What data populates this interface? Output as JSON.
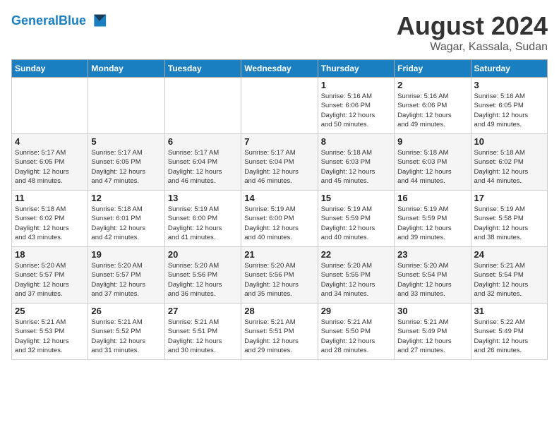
{
  "logo": {
    "line1": "General",
    "line2": "Blue"
  },
  "title": "August 2024",
  "subtitle": "Wagar, Kassala, Sudan",
  "days_of_week": [
    "Sunday",
    "Monday",
    "Tuesday",
    "Wednesday",
    "Thursday",
    "Friday",
    "Saturday"
  ],
  "weeks": [
    [
      {
        "day": "",
        "info": ""
      },
      {
        "day": "",
        "info": ""
      },
      {
        "day": "",
        "info": ""
      },
      {
        "day": "",
        "info": ""
      },
      {
        "day": "1",
        "info": "Sunrise: 5:16 AM\nSunset: 6:06 PM\nDaylight: 12 hours\nand 50 minutes."
      },
      {
        "day": "2",
        "info": "Sunrise: 5:16 AM\nSunset: 6:06 PM\nDaylight: 12 hours\nand 49 minutes."
      },
      {
        "day": "3",
        "info": "Sunrise: 5:16 AM\nSunset: 6:05 PM\nDaylight: 12 hours\nand 49 minutes."
      }
    ],
    [
      {
        "day": "4",
        "info": "Sunrise: 5:17 AM\nSunset: 6:05 PM\nDaylight: 12 hours\nand 48 minutes."
      },
      {
        "day": "5",
        "info": "Sunrise: 5:17 AM\nSunset: 6:05 PM\nDaylight: 12 hours\nand 47 minutes."
      },
      {
        "day": "6",
        "info": "Sunrise: 5:17 AM\nSunset: 6:04 PM\nDaylight: 12 hours\nand 46 minutes."
      },
      {
        "day": "7",
        "info": "Sunrise: 5:17 AM\nSunset: 6:04 PM\nDaylight: 12 hours\nand 46 minutes."
      },
      {
        "day": "8",
        "info": "Sunrise: 5:18 AM\nSunset: 6:03 PM\nDaylight: 12 hours\nand 45 minutes."
      },
      {
        "day": "9",
        "info": "Sunrise: 5:18 AM\nSunset: 6:03 PM\nDaylight: 12 hours\nand 44 minutes."
      },
      {
        "day": "10",
        "info": "Sunrise: 5:18 AM\nSunset: 6:02 PM\nDaylight: 12 hours\nand 44 minutes."
      }
    ],
    [
      {
        "day": "11",
        "info": "Sunrise: 5:18 AM\nSunset: 6:02 PM\nDaylight: 12 hours\nand 43 minutes."
      },
      {
        "day": "12",
        "info": "Sunrise: 5:18 AM\nSunset: 6:01 PM\nDaylight: 12 hours\nand 42 minutes."
      },
      {
        "day": "13",
        "info": "Sunrise: 5:19 AM\nSunset: 6:00 PM\nDaylight: 12 hours\nand 41 minutes."
      },
      {
        "day": "14",
        "info": "Sunrise: 5:19 AM\nSunset: 6:00 PM\nDaylight: 12 hours\nand 40 minutes."
      },
      {
        "day": "15",
        "info": "Sunrise: 5:19 AM\nSunset: 5:59 PM\nDaylight: 12 hours\nand 40 minutes."
      },
      {
        "day": "16",
        "info": "Sunrise: 5:19 AM\nSunset: 5:59 PM\nDaylight: 12 hours\nand 39 minutes."
      },
      {
        "day": "17",
        "info": "Sunrise: 5:19 AM\nSunset: 5:58 PM\nDaylight: 12 hours\nand 38 minutes."
      }
    ],
    [
      {
        "day": "18",
        "info": "Sunrise: 5:20 AM\nSunset: 5:57 PM\nDaylight: 12 hours\nand 37 minutes."
      },
      {
        "day": "19",
        "info": "Sunrise: 5:20 AM\nSunset: 5:57 PM\nDaylight: 12 hours\nand 37 minutes."
      },
      {
        "day": "20",
        "info": "Sunrise: 5:20 AM\nSunset: 5:56 PM\nDaylight: 12 hours\nand 36 minutes."
      },
      {
        "day": "21",
        "info": "Sunrise: 5:20 AM\nSunset: 5:56 PM\nDaylight: 12 hours\nand 35 minutes."
      },
      {
        "day": "22",
        "info": "Sunrise: 5:20 AM\nSunset: 5:55 PM\nDaylight: 12 hours\nand 34 minutes."
      },
      {
        "day": "23",
        "info": "Sunrise: 5:20 AM\nSunset: 5:54 PM\nDaylight: 12 hours\nand 33 minutes."
      },
      {
        "day": "24",
        "info": "Sunrise: 5:21 AM\nSunset: 5:54 PM\nDaylight: 12 hours\nand 32 minutes."
      }
    ],
    [
      {
        "day": "25",
        "info": "Sunrise: 5:21 AM\nSunset: 5:53 PM\nDaylight: 12 hours\nand 32 minutes."
      },
      {
        "day": "26",
        "info": "Sunrise: 5:21 AM\nSunset: 5:52 PM\nDaylight: 12 hours\nand 31 minutes."
      },
      {
        "day": "27",
        "info": "Sunrise: 5:21 AM\nSunset: 5:51 PM\nDaylight: 12 hours\nand 30 minutes."
      },
      {
        "day": "28",
        "info": "Sunrise: 5:21 AM\nSunset: 5:51 PM\nDaylight: 12 hours\nand 29 minutes."
      },
      {
        "day": "29",
        "info": "Sunrise: 5:21 AM\nSunset: 5:50 PM\nDaylight: 12 hours\nand 28 minutes."
      },
      {
        "day": "30",
        "info": "Sunrise: 5:21 AM\nSunset: 5:49 PM\nDaylight: 12 hours\nand 27 minutes."
      },
      {
        "day": "31",
        "info": "Sunrise: 5:22 AM\nSunset: 5:49 PM\nDaylight: 12 hours\nand 26 minutes."
      }
    ]
  ]
}
